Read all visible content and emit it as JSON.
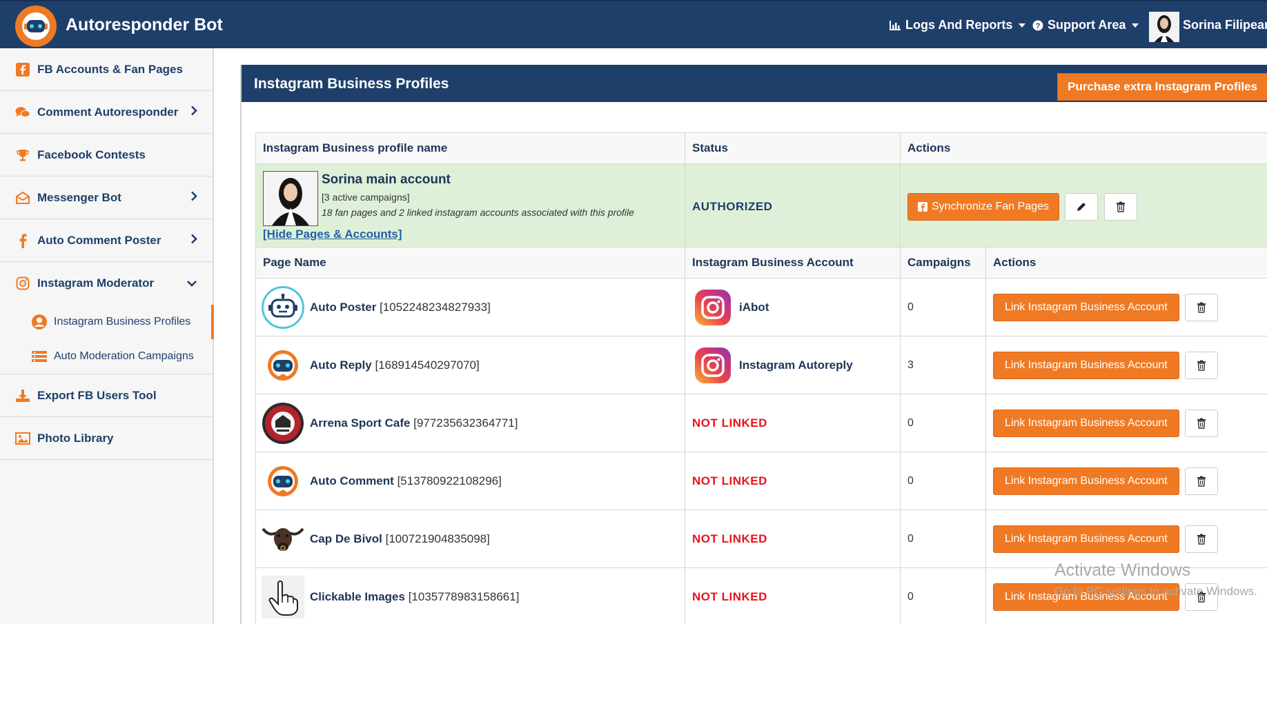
{
  "app": {
    "title": "Autoresponder Bot"
  },
  "topnav": {
    "logs": "Logs And Reports",
    "support": "Support Area",
    "user": "Sorina Filipeanu"
  },
  "sidebar": {
    "items": [
      {
        "label": "FB Accounts & Fan Pages",
        "icon": "facebook-icon"
      },
      {
        "label": "Comment Autoresponder",
        "icon": "comments-icon"
      },
      {
        "label": "Facebook Contests",
        "icon": "trophy-icon"
      },
      {
        "label": "Messenger Bot",
        "icon": "envelope-icon"
      },
      {
        "label": "Auto Comment Poster",
        "icon": "facebook-f-icon"
      },
      {
        "label": "Instagram Moderator",
        "icon": "instagram-icon"
      },
      {
        "label": "Export FB Users Tool",
        "icon": "download-icon"
      },
      {
        "label": "Photo Library",
        "icon": "image-icon"
      }
    ],
    "subitems": [
      {
        "label": "Instagram Business Profiles",
        "icon": "user-circle-icon"
      },
      {
        "label": "Auto Moderation Campaigns",
        "icon": "list-icon"
      }
    ]
  },
  "panel": {
    "title": "Instagram Business Profiles",
    "purchase_label": "Purchase extra Instagram Profiles"
  },
  "profile_table": {
    "headers": [
      "Instagram Business profile name",
      "Status",
      "Actions"
    ],
    "profile": {
      "name": "Sorina main account",
      "campaigns": "[3 active campaigns]",
      "associations": "18 fan pages and 2 linked instagram accounts associated with this profile",
      "hide_link": "[Hide Pages & Accounts]",
      "status": "AUTHORIZED",
      "sync_label": "Synchronize Fan Pages"
    }
  },
  "pages_table": {
    "headers": [
      "Page Name",
      "Instagram Business Account",
      "Campaigns",
      "Actions"
    ],
    "link_label": "Link Instagram Business Account",
    "not_linked": "NOT LINKED",
    "rows": [
      {
        "name": "Auto Poster",
        "id": "[1052248234827933]",
        "ig": "iAbot",
        "campaigns": "0",
        "icon": "robot-icon"
      },
      {
        "name": "Auto Reply",
        "id": "[168914540297070]",
        "ig": "Instagram Autoreply",
        "campaigns": "3",
        "icon": "bot-logo-icon"
      },
      {
        "name": "Arrena Sport Cafe",
        "id": "[977235632364771]",
        "ig": "",
        "campaigns": "0",
        "icon": "arrena-logo-icon"
      },
      {
        "name": "Auto Comment",
        "id": "[513780922108296]",
        "ig": "",
        "campaigns": "0",
        "icon": "bot-logo-icon"
      },
      {
        "name": "Cap De Bivol",
        "id": "[100721904835098]",
        "ig": "",
        "campaigns": "0",
        "icon": "bull-icon"
      },
      {
        "name": "Clickable Images",
        "id": "[1035778983158661]",
        "ig": "",
        "campaigns": "0",
        "icon": "hand-cursor-icon"
      }
    ]
  },
  "watermark": {
    "line1": "Activate Windows",
    "line2": "Go to PC settings to activate Windows."
  }
}
